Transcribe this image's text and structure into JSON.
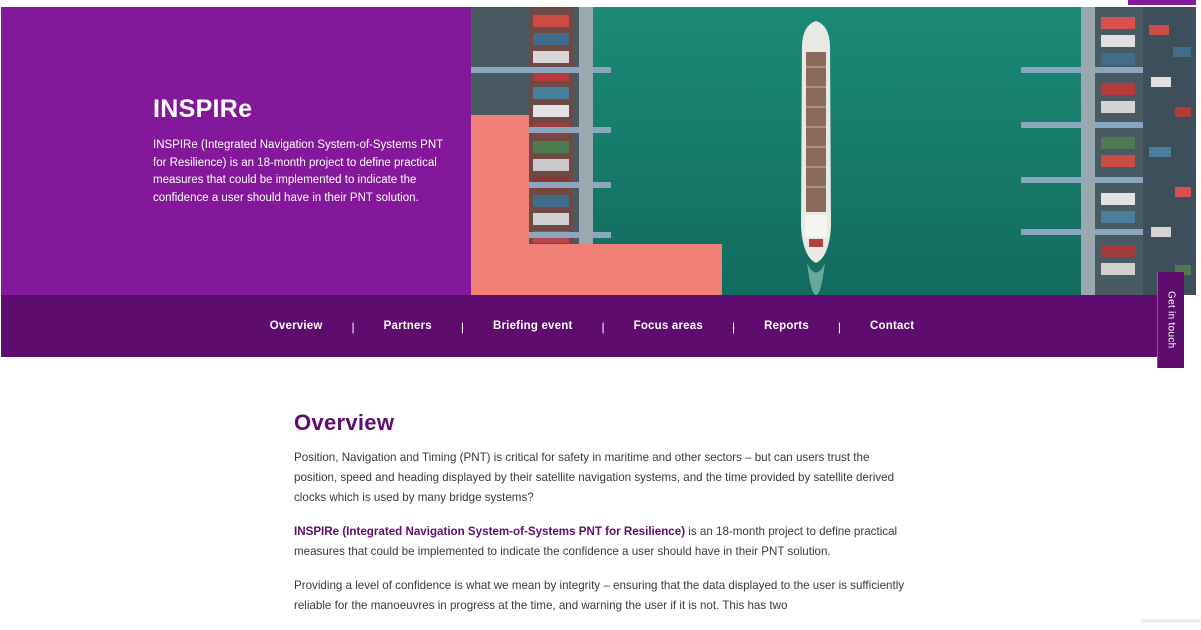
{
  "hero": {
    "title": "INSPIRe",
    "description": "INSPIRe (Integrated Navigation System-of-Systems PNT for Resilience) is an 18-month project to define practical measures that could be implemented to indicate the confidence a user should have in their PNT solution."
  },
  "nav": {
    "items": [
      {
        "label": "Overview"
      },
      {
        "label": "Partners"
      },
      {
        "label": "Briefing event"
      },
      {
        "label": "Focus areas"
      },
      {
        "label": "Reports"
      },
      {
        "label": "Contact"
      }
    ],
    "separator": "|"
  },
  "side_tab": {
    "label": "Get in touch"
  },
  "content": {
    "heading": "Overview",
    "p1": "Position, Navigation and Timing (PNT) is critical for safety in maritime and other sectors – but can users trust the position, speed and heading displayed by their satellite navigation systems, and the time provided by satellite derived clocks which is used by many bridge systems?",
    "p2_strong": "INSPIRe (Integrated Navigation System-of-Systems PNT for Resilience)",
    "p2_rest": " is an 18-month project to define practical measures that could be implemented to indicate the confidence a user should have in their PNT solution.",
    "p3": "Providing a level of confidence is what we mean by integrity – ensuring that the data displayed to the user is sufficiently reliable for the manoeuvres in progress at the time, and warning the user if it is not. This has two"
  },
  "colors": {
    "brand_purple": "#84189a",
    "dark_purple": "#5e0d6e",
    "water": "#17806e",
    "salmon": "#f07f78"
  }
}
